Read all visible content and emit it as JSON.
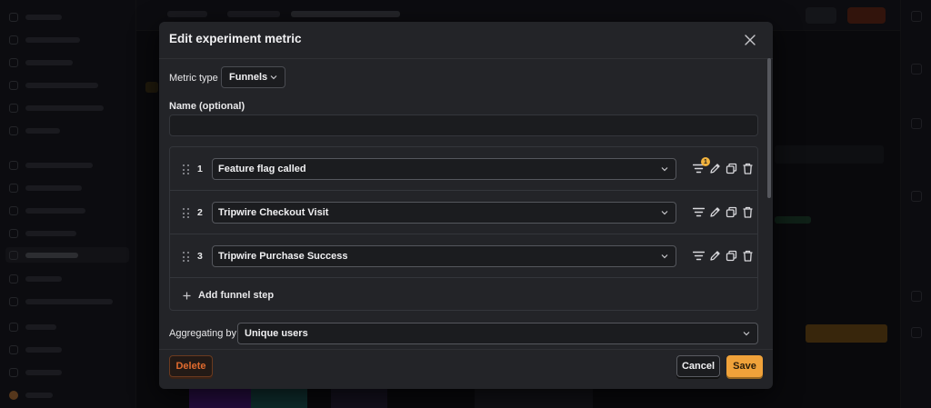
{
  "modal": {
    "title": "Edit experiment metric",
    "metric_type_label": "Metric type",
    "metric_type_value": "Funnels",
    "name_label": "Name (optional)",
    "name_value": "",
    "steps": [
      {
        "number": "1",
        "event": "Feature flag called",
        "filter_count": "1"
      },
      {
        "number": "2",
        "event": "Tripwire Checkout Visit",
        "filter_count": ""
      },
      {
        "number": "3",
        "event": "Tripwire Purchase Success",
        "filter_count": ""
      }
    ],
    "add_step_label": "Add funnel step",
    "aggregating_label": "Aggregating by",
    "aggregating_value": "Unique users",
    "delete_label": "Delete",
    "cancel_label": "Cancel",
    "save_label": "Save"
  },
  "colors": {
    "modal_bg": "#232428",
    "accent_save": "#f0a23a",
    "danger": "#e06a2e",
    "badge": "#f2b33d"
  },
  "icons": {
    "close": "close-icon",
    "chevron": "chevron-down-icon",
    "drag": "drag-handle-icon",
    "filter": "filter-icon",
    "edit": "pencil-icon",
    "duplicate": "copy-icon",
    "delete": "trash-icon",
    "add": "plus-icon"
  }
}
